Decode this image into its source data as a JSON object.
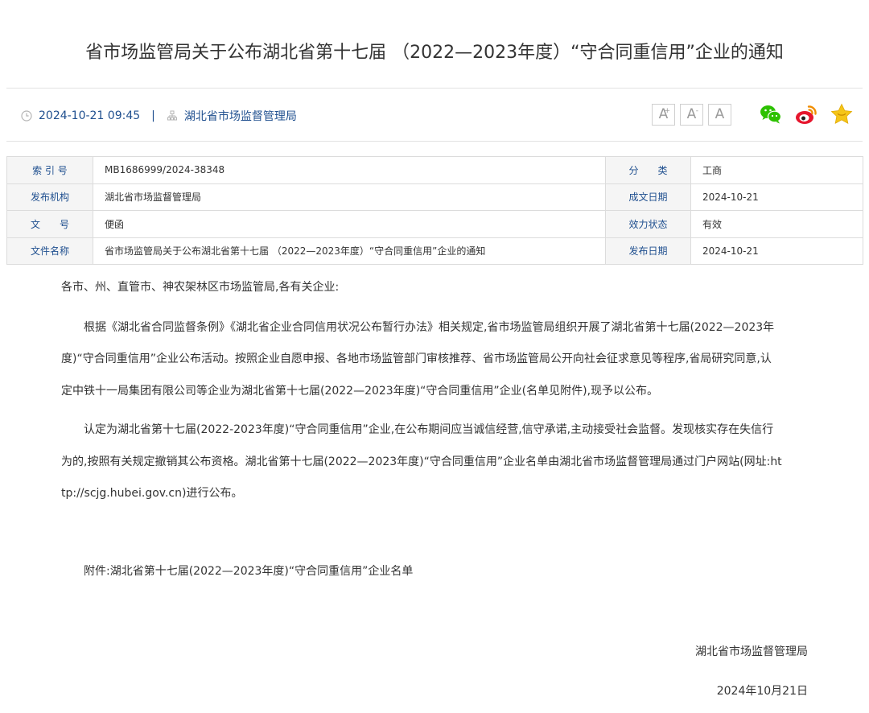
{
  "title": "省市场监管局关于公布湖北省第十七届 （2022—2023年度）“守合同重信用”企业的通知",
  "meta": {
    "datetime": "2024-10-21 09:45",
    "separator": "|",
    "source": "湖北省市场监督管理局"
  },
  "tools": {
    "font_large": "A",
    "font_small": "A",
    "font_normal": "A",
    "sup_plus": "+",
    "sup_minus": "-",
    "icons": [
      "wechat-icon",
      "weibo-icon",
      "favorite-star-icon"
    ]
  },
  "info_table": {
    "rows": [
      {
        "label1": "索 引 号",
        "value1": "MB1686999/2024-38348",
        "label2": "分　　类",
        "value2": "工商"
      },
      {
        "label1": "发布机构",
        "value1": "湖北省市场监督管理局",
        "label2": "成文日期",
        "value2": "2024-10-21"
      },
      {
        "label1": "文　　号",
        "value1": "便函",
        "label2": "效力状态",
        "value2": "有效"
      },
      {
        "label1": "文件名称",
        "value1": "省市场监管局关于公布湖北省第十七届 （2022—2023年度）“守合同重信用”企业的通知",
        "label2": "发布日期",
        "value2": "2024-10-21"
      }
    ]
  },
  "body": {
    "salutation": "各市、州、直管市、神农架林区市场监管局,各有关企业:",
    "para1": [
      "根据《湖北省合同监督条例》《湖北省企业合同信用状况公布暂行办法》相关规定,省市场监管局组织开展了湖北省第十七届(2022—2023年",
      "度)“守合同重信用”企业公布活动。按照企业自愿申报、各地市场监管部门审核推荐、省市场监管局公开向社会征求意见等程序,省局研究同意,认",
      "定中铁十一局集团有限公司等企业为湖北省第十七届(2022—2023年度)“守合同重信用”企业(名单见附件),现予以公布。"
    ],
    "para2": [
      "认定为湖北省第十七届(2022-2023年度)“守合同重信用”企业,在公布期间应当诚信经营,信守承诺,主动接受社会监督。发现核实存在失信行",
      "为的,按照有关规定撤销其公布资格。湖北省第十七届(2022—2023年度)“守合同重信用”企业名单由湖北省市场监督管理局通过门户网站(网址:ht",
      "tp://scjg.hubei.gov.cn)进行公布。"
    ],
    "attachment": "附件:湖北省第十七届(2022—2023年度)“守合同重信用”企业名单",
    "signature": "湖北省市场监督管理局",
    "date": "2024年10月21日"
  },
  "colors": {
    "link_blue": "#1f4f8f",
    "wechat_green": "#2dc100",
    "weibo_orange": "#f08d00",
    "star_yellow": "#f5c518"
  }
}
